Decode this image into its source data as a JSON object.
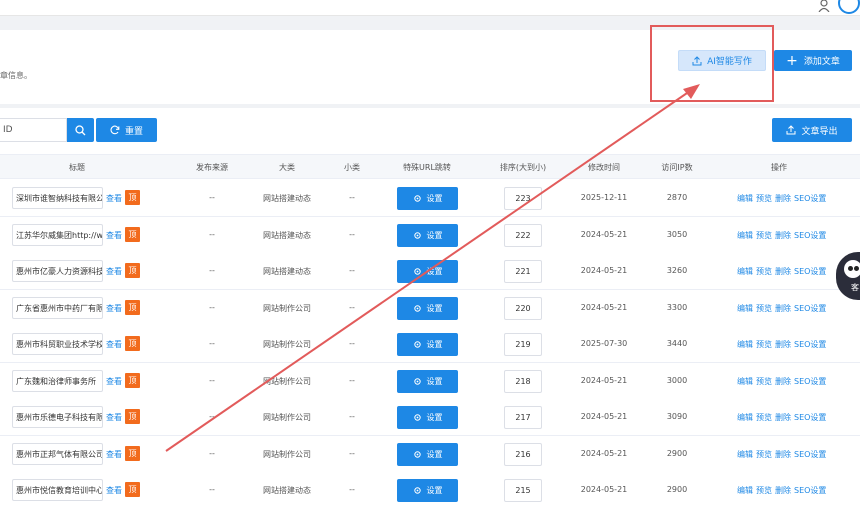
{
  "header": {
    "desc_suffix": "章信息。",
    "ai_button": "AI智能写作",
    "add_button": "添加文章"
  },
  "filters": {
    "search_value": "ID",
    "reset_button": "重置",
    "export_button": "文章导出"
  },
  "table": {
    "columns": [
      "标题",
      "发布来源",
      "大类",
      "小类",
      "特殊URL跳转",
      "排序(大到小)",
      "修改时间",
      "访问IP数",
      "操作"
    ],
    "view_label": "查看",
    "top_label": "顶",
    "set_label": "设置",
    "ops": [
      "编辑",
      "预览",
      "删除",
      "SEO设置"
    ],
    "rows": [
      {
        "title": "深圳市谁智纳科技有限公",
        "source": "--",
        "category": "网站搭建动态",
        "subcategory": "--",
        "sort": "223",
        "modified": "2025-12-11",
        "ip_count": "2870"
      },
      {
        "title": "江苏华尔威集团http://w",
        "source": "--",
        "category": "网站搭建动态",
        "subcategory": "--",
        "sort": "222",
        "modified": "2024-05-21",
        "ip_count": "3050"
      },
      {
        "title": "惠州市亿豪人力资源科技",
        "source": "--",
        "category": "网站搭建动态",
        "subcategory": "--",
        "sort": "221",
        "modified": "2024-05-21",
        "ip_count": "3260"
      },
      {
        "title": "广东省惠州市中药厂有限",
        "source": "--",
        "category": "网站制作公司",
        "subcategory": "--",
        "sort": "220",
        "modified": "2024-05-21",
        "ip_count": "3300"
      },
      {
        "title": "惠州市科贸职业技术学校",
        "source": "--",
        "category": "网站制作公司",
        "subcategory": "--",
        "sort": "219",
        "modified": "2025-07-30",
        "ip_count": "3440"
      },
      {
        "title": "广东魏和治律师事务所",
        "source": "--",
        "category": "网站制作公司",
        "subcategory": "--",
        "sort": "218",
        "modified": "2024-05-21",
        "ip_count": "3000"
      },
      {
        "title": "惠州市乐德电子科技有限",
        "source": "--",
        "category": "网站制作公司",
        "subcategory": "--",
        "sort": "217",
        "modified": "2024-05-21",
        "ip_count": "3090"
      },
      {
        "title": "惠州市正邦气体有限公司",
        "source": "--",
        "category": "网站制作公司",
        "subcategory": "--",
        "sort": "216",
        "modified": "2024-05-21",
        "ip_count": "2900"
      },
      {
        "title": "惠州市悦信教育培训中心",
        "source": "--",
        "category": "网站搭建动态",
        "subcategory": "--",
        "sort": "215",
        "modified": "2024-05-21",
        "ip_count": "2900"
      }
    ]
  },
  "widget": {
    "label": "客"
  },
  "colors": {
    "primary": "#1e88e5",
    "accent_orange": "#f26b1d",
    "annotation_red": "#e25b5b"
  }
}
